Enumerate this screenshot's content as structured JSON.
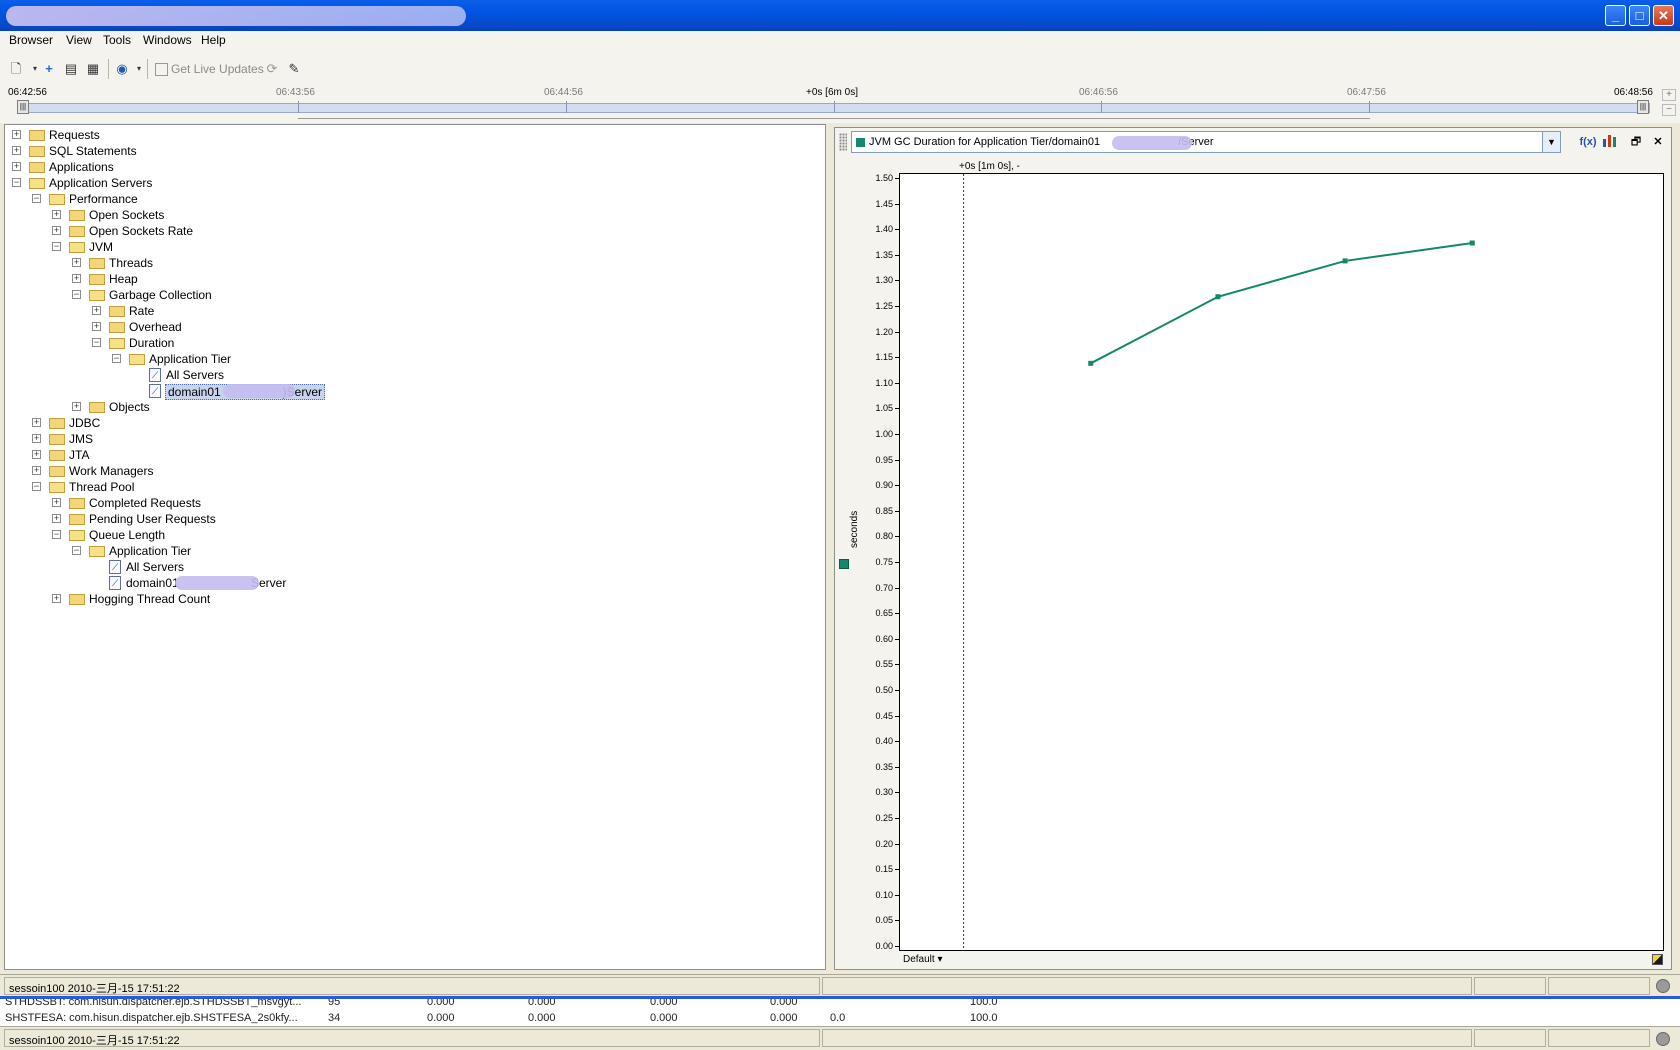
{
  "menubar": {
    "items": [
      "Browser",
      "View",
      "Tools",
      "Windows",
      "Help"
    ]
  },
  "toolbar": {
    "live_updates_label": "Get Live Updates",
    "live_updates_checked": false,
    "icons": [
      "new-icon",
      "add-icon",
      "properties-icon",
      "settings-icon",
      "globe-icon",
      "refresh-icon",
      "pin-icon"
    ]
  },
  "timeline": {
    "start": "06:42:56",
    "ticks": [
      "06:43:56",
      "06:44:56",
      "06:46:56",
      "06:47:56"
    ],
    "span_label": "+0s [6m 0s]",
    "end": "06:48:56"
  },
  "tree": {
    "requests": "Requests",
    "sql_statements": "SQL Statements",
    "applications": "Applications",
    "application_servers": "Application Servers",
    "performance": "Performance",
    "open_sockets": "Open Sockets",
    "open_sockets_rate": "Open Sockets Rate",
    "jvm": "JVM",
    "threads": "Threads",
    "heap": "Heap",
    "garbage_collection": "Garbage Collection",
    "rate": "Rate",
    "overhead": "Overhead",
    "duration": "Duration",
    "application_tier": "Application Tier",
    "all_servers": "All Servers",
    "domain_server_prefix": "domain01",
    "domain_server_suffix": ")Server",
    "objects": "Objects",
    "jdbc": "JDBC",
    "jms": "JMS",
    "jta": "JTA",
    "work_managers": "Work Managers",
    "thread_pool": "Thread Pool",
    "completed_requests": "Completed Requests",
    "pending_user_requests": "Pending User Requests",
    "queue_length": "Queue Length",
    "qa_application_tier": "Application Tier",
    "qa_all_servers": "All Servers",
    "qa_domain_prefix": "domain01",
    "qa_domain_suffix": "Server",
    "hogging_thread_count": "Hogging Thread Count"
  },
  "chart_panel": {
    "title_prefix": "JVM GC Duration for Application Tier/domain01",
    "title_suffix": "/Server",
    "marker": "+0s [1m 0s], -",
    "default_label": "Default",
    "colors": {
      "series": "#14876c"
    }
  },
  "chart_data": {
    "type": "line",
    "ylabel": "seconds",
    "ylim": [
      0.0,
      1.5
    ],
    "yticks": [
      "0.00",
      "0.05",
      "0.10",
      "0.15",
      "0.20",
      "0.25",
      "0.30",
      "0.35",
      "0.40",
      "0.45",
      "0.50",
      "0.55",
      "0.60",
      "0.65",
      "0.70",
      "0.75",
      "0.80",
      "0.85",
      "0.90",
      "0.95",
      "1.00",
      "1.05",
      "1.10",
      "1.15",
      "1.20",
      "1.25",
      "1.30",
      "1.35",
      "1.40",
      "1.45",
      "1.50"
    ],
    "x_minutes_span": 6,
    "series": [
      {
        "x": [
          1.5,
          2.5,
          3.5,
          4.5
        ],
        "values": [
          1.14,
          1.27,
          1.34,
          1.375
        ]
      }
    ]
  },
  "status": {
    "session": "sessoin100 2010-三月-15 17:51:22"
  },
  "background_window": {
    "row1": [
      "STHDSSBT: com.hisun.dispatcher.ejb.STHDSSBT_msvgyt...",
      "95",
      "0.000",
      "0.000",
      "0.000",
      "0.000",
      "100.0"
    ],
    "row2": [
      "SHSTFESA: com.hisun.dispatcher.ejb.SHSTFESA_2s0kfy...",
      "34",
      "0.000",
      "0.000",
      "0.000",
      "0.000",
      "0.0",
      "100.0"
    ]
  }
}
